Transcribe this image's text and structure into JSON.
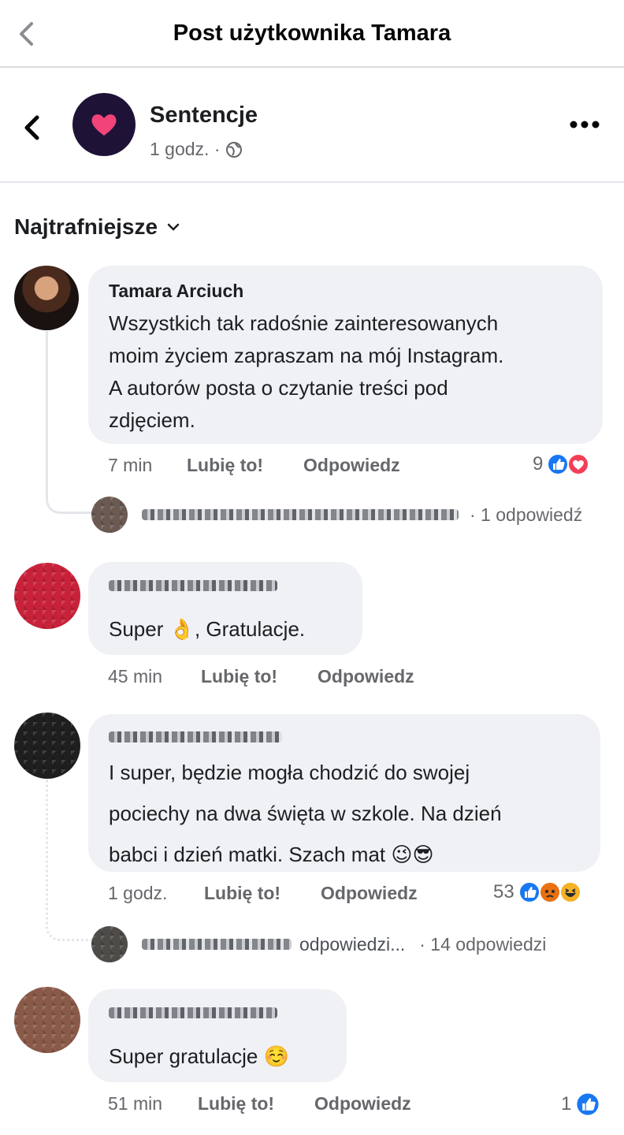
{
  "topbar": {
    "title": "Post użytkownika Tamara"
  },
  "post": {
    "page_name": "Sentencje",
    "time": "1 godz. ·"
  },
  "sort": {
    "label": "Najtrafniejsze"
  },
  "comments": [
    {
      "author": "Tamara Arciuch",
      "lines": [
        "Wszystkich tak radośnie zainteresowanych",
        "moim życiem zapraszam na mój Instagram.",
        "A autorów posta o czytanie treści pod",
        "zdjęciem."
      ],
      "time": "7 min",
      "like": "Lubię to!",
      "reply": "Odpowiedz",
      "reactions": "9",
      "replies": "· 1 odpowiedź"
    },
    {
      "author": "",
      "lines": [
        "Super 👌, Gratulacje."
      ],
      "time": "45 min",
      "like": "Lubię to!",
      "reply": "Odpowiedz"
    },
    {
      "author": "",
      "lines": [
        "I super, będzie mogła chodzić do swojej",
        "pociechy na dwa święta w szkole. Na dzień",
        "babci i dzień matki. Szach mat 😉😎"
      ],
      "time": "1 godz.",
      "like": "Lubię to!",
      "reply": "Odpowiedz",
      "reactions": "53",
      "reply_preview": "odpowiedzi...",
      "replies": "· 14 odpowiedzi"
    },
    {
      "author": "",
      "lines": [
        "Super gratulacje ☺️"
      ],
      "time": "51 min",
      "like": "Lubię to!",
      "reply": "Odpowiedz",
      "reactions": "1"
    }
  ],
  "colors": {
    "like_blue": "#1877f2",
    "love_red": "#f33e58",
    "bubble": "#eff1f4",
    "meta_gray": "#65676b"
  }
}
